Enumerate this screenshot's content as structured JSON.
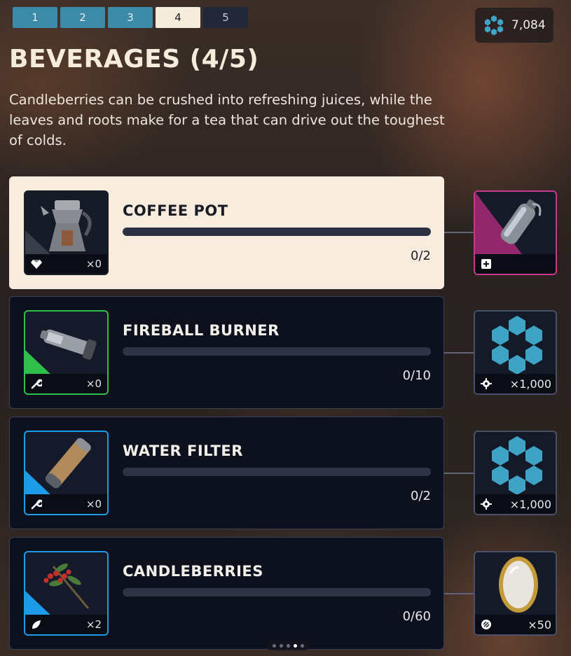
{
  "tabs": [
    {
      "label": "1",
      "state": "completed"
    },
    {
      "label": "2",
      "state": "completed"
    },
    {
      "label": "3",
      "state": "completed"
    },
    {
      "label": "4",
      "state": "active"
    },
    {
      "label": "5",
      "state": "locked"
    }
  ],
  "currency": {
    "icon": "gear-cog-icon",
    "value": "7,084"
  },
  "title": "BEVERAGES (4/5)",
  "description": "Candleberries can be crushed into refreshing juices, while the leaves and roots make for a tea that can drive out the toughest of colds.",
  "items": [
    {
      "name": "COFFEE POT",
      "progress_text": "0/2",
      "progress_fraction": 0,
      "item_icon": "coffee-pot-icon",
      "foot_icon": "gem-icon",
      "count": "×0",
      "rarity_color": "#cfcfd4",
      "highlight": true,
      "reward": {
        "icon": "spray-can-icon",
        "foot_icon": "plus-box-icon",
        "count": "",
        "rarity_color": "#c7388d"
      }
    },
    {
      "name": "FIREBALL BURNER",
      "progress_text": "0/10",
      "progress_fraction": 0,
      "item_icon": "burner-icon",
      "foot_icon": "wrench-icon",
      "count": "×0",
      "rarity_color": "#2fbf4a",
      "highlight": false,
      "reward": {
        "icon": "hex-cog-icon",
        "foot_icon": "gear-icon",
        "count": "×1,000",
        "rarity_color": "#4a5068"
      }
    },
    {
      "name": "WATER FILTER",
      "progress_text": "0/2",
      "progress_fraction": 0,
      "item_icon": "water-filter-icon",
      "foot_icon": "wrench-icon",
      "count": "×0",
      "rarity_color": "#1e9be6",
      "highlight": false,
      "reward": {
        "icon": "hex-cog-icon",
        "foot_icon": "gear-icon",
        "count": "×1,000",
        "rarity_color": "#4a5068"
      }
    },
    {
      "name": "CANDLEBERRIES",
      "progress_text": "0/60",
      "progress_fraction": 0,
      "item_icon": "berry-sprig-icon",
      "foot_icon": "leaf-icon",
      "count": "×2",
      "rarity_color": "#1e9be6",
      "highlight": false,
      "reward": {
        "icon": "mirror-icon",
        "foot_icon": "coin-icon",
        "count": "×50",
        "rarity_color": "#4a5068"
      }
    }
  ],
  "pager": {
    "count": 5,
    "active_index": 3
  }
}
